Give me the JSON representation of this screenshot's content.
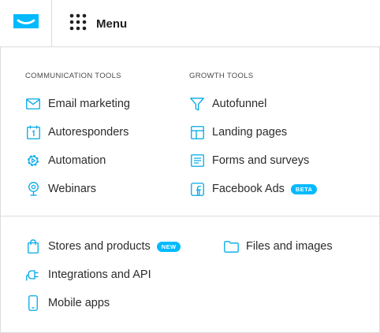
{
  "header": {
    "menu_label": "Menu",
    "logo_icon": "getresponse-envelope-logo",
    "grid_icon": "grid-dots-icon"
  },
  "menu": {
    "communication": {
      "heading": "COMMUNICATION TOOLS",
      "items": [
        {
          "label": "Email marketing",
          "icon": "envelope-icon"
        },
        {
          "label": "Autoresponders",
          "icon": "calendar-icon"
        },
        {
          "label": "Automation",
          "icon": "gear-icon"
        },
        {
          "label": "Webinars",
          "icon": "webcam-icon"
        }
      ]
    },
    "growth": {
      "heading": "GROWTH TOOLS",
      "items": [
        {
          "label": "Autofunnel",
          "icon": "funnel-icon"
        },
        {
          "label": "Landing pages",
          "icon": "layout-icon"
        },
        {
          "label": "Forms and surveys",
          "icon": "form-icon"
        },
        {
          "label": "Facebook Ads",
          "icon": "facebook-icon",
          "badge": "BETA"
        }
      ]
    },
    "more": {
      "items": [
        {
          "label": "Stores and products",
          "icon": "shopping-bag-icon",
          "badge": "NEW"
        },
        {
          "label": "Integrations and API",
          "icon": "plug-icon"
        },
        {
          "label": "Mobile apps",
          "icon": "phone-icon"
        },
        {
          "label": "Files and images",
          "icon": "folder-icon"
        }
      ]
    }
  },
  "colors": {
    "accent": "#00baff",
    "text": "#2b2b2b",
    "border": "#dcdcdc"
  }
}
